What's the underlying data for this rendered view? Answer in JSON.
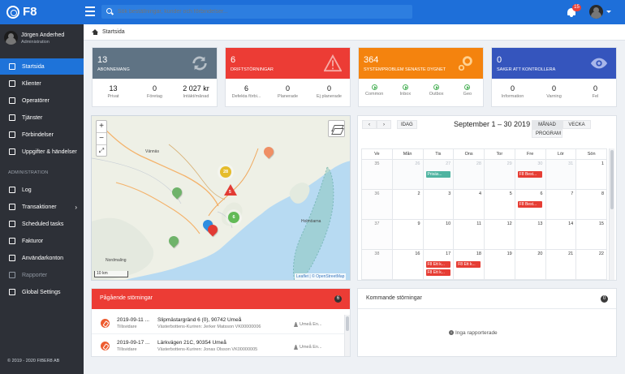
{
  "app": {
    "logo_text": "F8",
    "search_placeholder": "Sök beställningar, kunder och förbindelser...",
    "notification_count": "15",
    "accent": "#1e6fd9"
  },
  "user": {
    "name": "Jörgen Anderhed",
    "role": "Administration"
  },
  "nav": {
    "items": [
      {
        "label": "Startsida",
        "icon": "home-icon"
      },
      {
        "label": "Klienter",
        "icon": "monitor-icon"
      },
      {
        "label": "Operatörer",
        "icon": "antenna-icon"
      },
      {
        "label": "Tjänster",
        "icon": "layers-icon"
      },
      {
        "label": "Förbindelser",
        "icon": "link-icon"
      },
      {
        "label": "Uppgifter & händelser",
        "icon": "calendar-check-icon"
      }
    ],
    "section_label": "ADMINISTRATION",
    "admin_items": [
      {
        "label": "Log",
        "icon": "list-icon"
      },
      {
        "label": "Transaktioner",
        "icon": "transfer-icon"
      },
      {
        "label": "Scheduled tasks",
        "icon": "clock-icon"
      },
      {
        "label": "Fakturor",
        "icon": "invoice-icon"
      },
      {
        "label": "Användarkonton",
        "icon": "users-icon"
      },
      {
        "label": "Rapporter",
        "icon": "report-icon"
      },
      {
        "label": "Global Settings",
        "icon": "gear-icon"
      }
    ],
    "copyright": "© 2019 - 2020 FIBER8 AB"
  },
  "breadcrumb": "Startsida",
  "stats": [
    {
      "value": "13",
      "caption": "ABONNEMANG",
      "color": "#5f7384",
      "icon": "refresh-icon",
      "metrics": [
        {
          "value": "13",
          "label": "Privat"
        },
        {
          "value": "0",
          "label": "Företag"
        },
        {
          "value": "2 027 kr",
          "label": "Intäkt/månad"
        }
      ]
    },
    {
      "value": "6",
      "caption": "DRIFTSTÖRNINGAR",
      "color": "#ec3c35",
      "icon": "warning-icon",
      "metrics": [
        {
          "value": "6",
          "label": "Defekta förbi..."
        },
        {
          "value": "0",
          "label": "Planerade"
        },
        {
          "value": "0",
          "label": "Ej planerade"
        }
      ]
    },
    {
      "value": "364",
      "caption": "SYSTEMPROBLEM SENASTE DYGNET",
      "color": "#f4830e",
      "icon": "cogs-icon",
      "metrics": [
        {
          "value": "",
          "label": "Common"
        },
        {
          "value": "",
          "label": "Inbox"
        },
        {
          "value": "",
          "label": "Outbox"
        },
        {
          "value": "",
          "label": "Geo"
        }
      ]
    },
    {
      "value": "0",
      "caption": "SAKER ATT KONTROLLERA",
      "color": "#3555bd",
      "icon": "eye-icon",
      "metrics": [
        {
          "value": "0",
          "label": "Information"
        },
        {
          "value": "0",
          "label": "Varning"
        },
        {
          "value": "0",
          "label": "Fel"
        }
      ]
    }
  ],
  "map": {
    "zoom_in": "+",
    "zoom_out": "−",
    "fullscreen": "⤢",
    "scale": "10 km",
    "attribution": "Leaflet | © OpenStreetMap",
    "labels": [
      "Vännäs",
      "Holmöarna",
      "Nordmaling"
    ],
    "clusters": [
      "28",
      "6"
    ],
    "warnings": [
      "5"
    ]
  },
  "calendar": {
    "title": "September 1 – 30 2019",
    "today": "IDAG",
    "views": [
      "MÅNAD",
      "VECKA",
      "PROGRAM"
    ],
    "weekday_headers": [
      "Ve",
      "Mån",
      "Tis",
      "Ons",
      "Tor",
      "Fre",
      "Lör",
      "Sön"
    ],
    "weeks": [
      [
        "35",
        "26",
        "27",
        "28",
        "29",
        "30",
        "31",
        "1"
      ],
      [
        "36",
        "2",
        "3",
        "4",
        "5",
        "6",
        "7",
        "8"
      ],
      [
        "37",
        "9",
        "10",
        "11",
        "12",
        "13",
        "14",
        "15"
      ],
      [
        "38",
        "16",
        "17",
        "18",
        "19",
        "20",
        "21",
        "22"
      ]
    ],
    "events": {
      "teal": "Prisäs...",
      "red": "F8 Best...",
      "red_alt": "F8 Ett k..."
    }
  },
  "ongoing": {
    "title": "Pågående störningar",
    "count": "6",
    "rows": [
      {
        "date": "2019-09-11 ...",
        "type": "Tillsvidare",
        "address": "Slipmästargränd 6 (0), 90742 Umeå",
        "person": "Västerbottens-Kuriren: Jerker Matsson VK00000006",
        "area": "Umeå En..."
      },
      {
        "date": "2019-09-17 ...",
        "type": "Tillsvidare",
        "address": "Lärkvägen 21C, 90354 Umeå",
        "person": "Västerbottens-Kuriren: Jonas Olsson VK00000005",
        "area": "Umeå En..."
      }
    ]
  },
  "upcoming": {
    "title": "Kommande störningar",
    "count": "0",
    "empty": "Inga rapporterade"
  }
}
